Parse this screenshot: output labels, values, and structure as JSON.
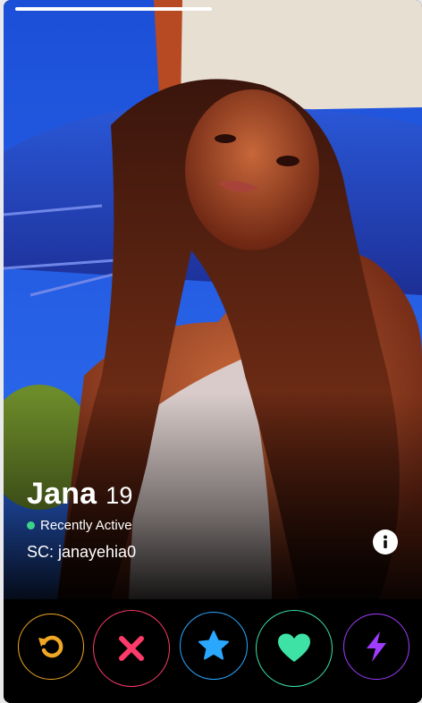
{
  "profile": {
    "name": "Jana",
    "age": "19",
    "status": "Recently Active",
    "bio": "SC: janayehia0",
    "photo_progress": 0.5
  },
  "colors": {
    "active_dot": "#3dd28a",
    "rewind": "#f0a724",
    "nope": "#fd3a6a",
    "super_like": "#2aa7ff",
    "like": "#3de2a4",
    "boost": "#a03cff"
  },
  "icons": {
    "rewind": "rewind-icon",
    "nope": "close-icon",
    "super_like": "star-icon",
    "like": "heart-icon",
    "boost": "lightning-icon",
    "info": "info-icon"
  }
}
